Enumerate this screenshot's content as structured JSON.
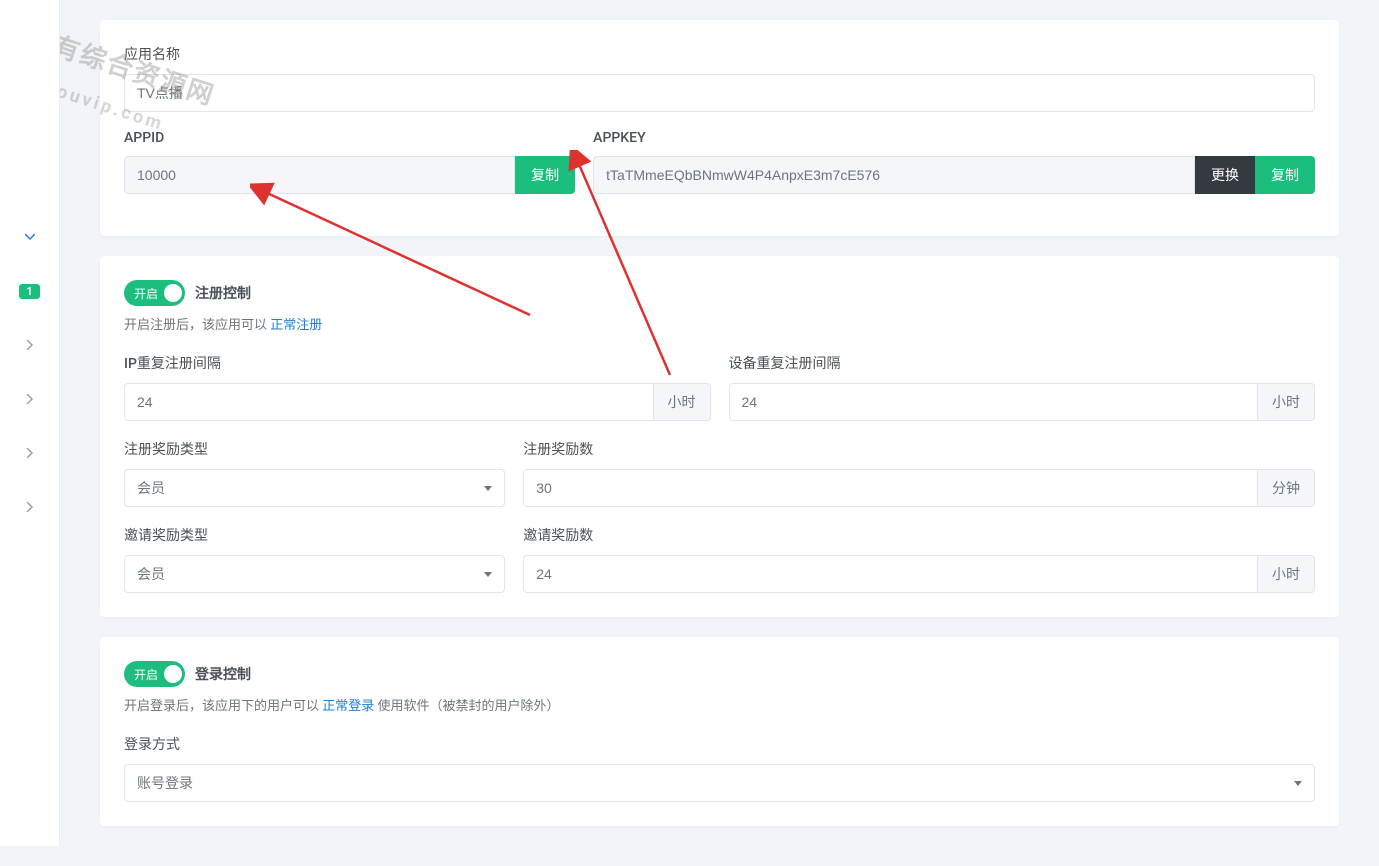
{
  "watermark": {
    "line1": "全都有综合资源网",
    "line2": "douyouvip.com"
  },
  "sidebar": {
    "badge": "1"
  },
  "app": {
    "name_label": "应用名称",
    "name_value": "TV点播",
    "appid_label": "APPID",
    "appid_value": "10000",
    "appkey_label": "APPKEY",
    "appkey_value": "tTaTMmeEQbBNmwW4P4AnpxE3m7cE576",
    "copy_btn": "复制",
    "change_btn": "更换"
  },
  "register": {
    "toggle_label": "开启",
    "title": "注册控制",
    "hint_prefix": "开启注册后，该应用可以 ",
    "hint_link": "正常注册",
    "ip_interval_label": "IP重复注册间隔",
    "ip_interval_value": "24",
    "ip_interval_unit": "小时",
    "device_interval_label": "设备重复注册间隔",
    "device_interval_value": "24",
    "device_interval_unit": "小时",
    "reward_type_label": "注册奖励类型",
    "reward_type_value": "会员",
    "reward_count_label": "注册奖励数",
    "reward_count_value": "30",
    "reward_count_unit": "分钟",
    "invite_type_label": "邀请奖励类型",
    "invite_type_value": "会员",
    "invite_count_label": "邀请奖励数",
    "invite_count_value": "24",
    "invite_count_unit": "小时"
  },
  "login": {
    "toggle_label": "开启",
    "title": "登录控制",
    "hint_prefix": "开启登录后，该应用下的用户可以 ",
    "hint_link": "正常登录",
    "hint_suffix": " 使用软件（被禁封的用户除外）",
    "method_label": "登录方式",
    "method_value": "账号登录"
  }
}
